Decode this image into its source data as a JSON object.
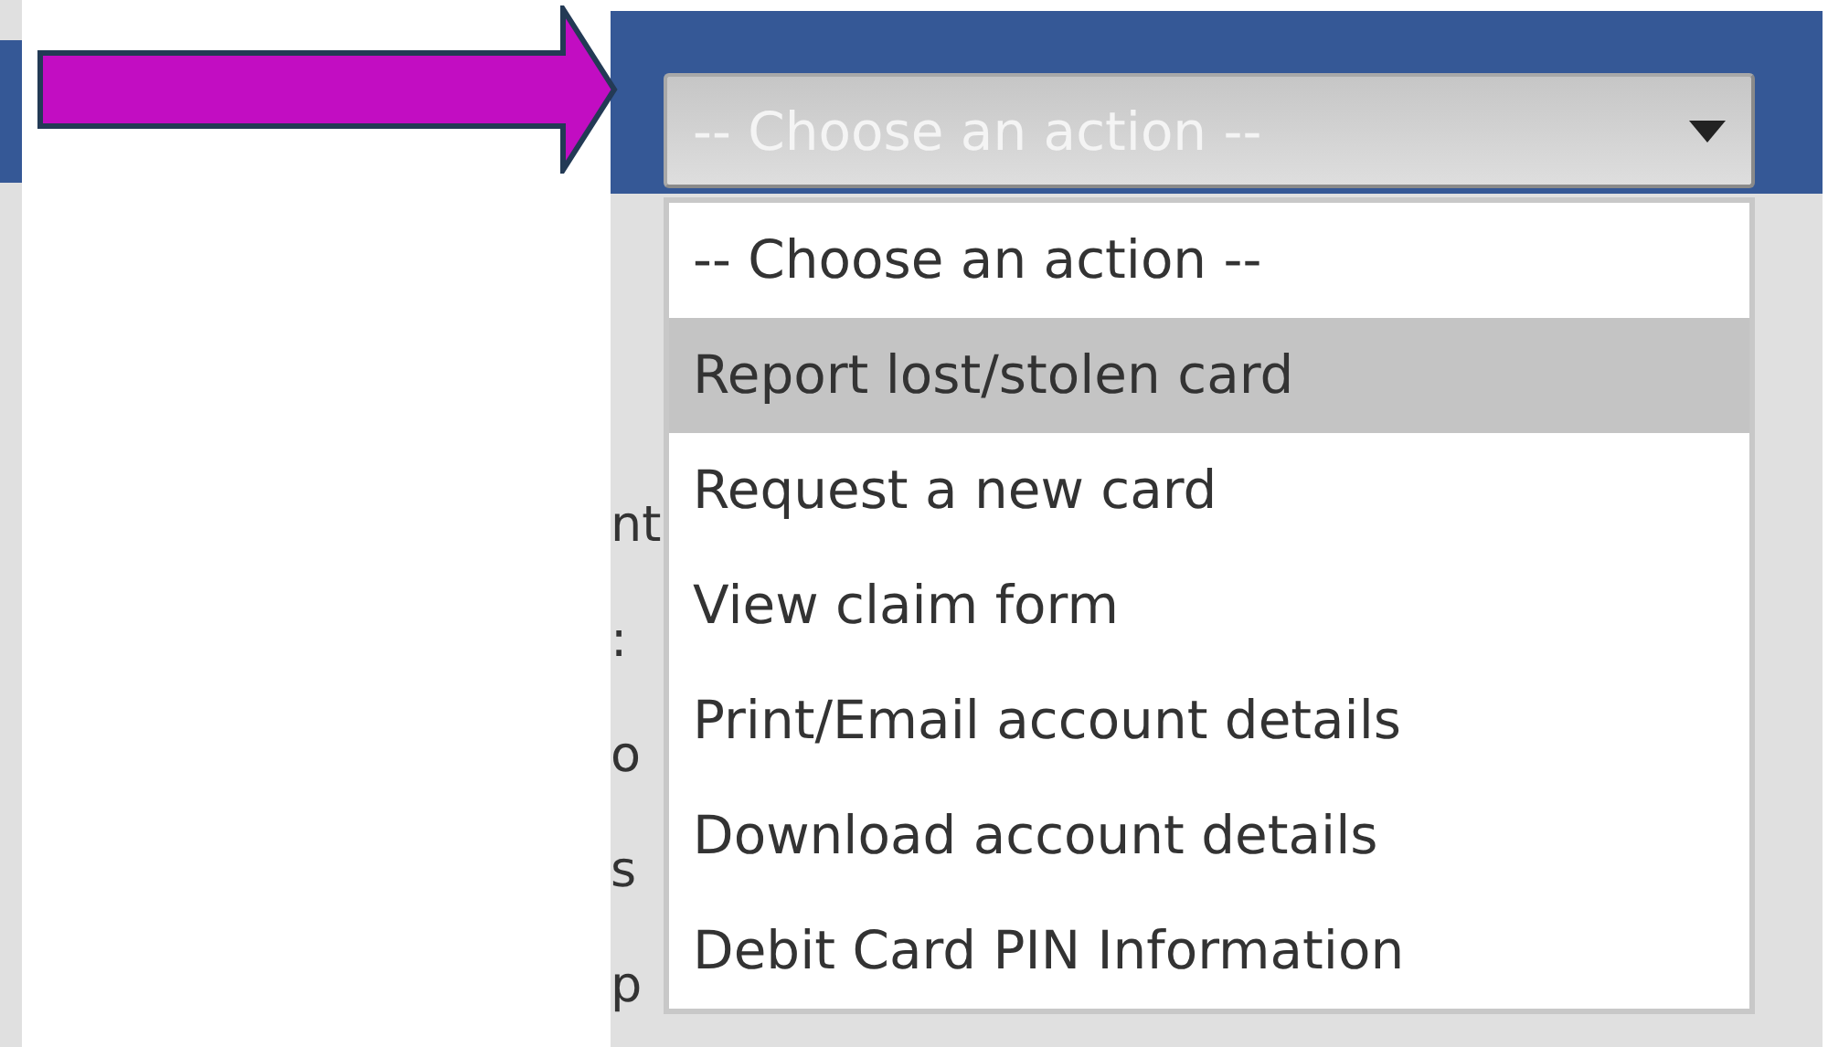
{
  "select": {
    "value": "-- Choose an action --",
    "expanded": true
  },
  "options": [
    {
      "label": "-- Choose an action --",
      "selected": false
    },
    {
      "label": "Report lost/stolen card",
      "selected": true
    },
    {
      "label": "Request a new card",
      "selected": false
    },
    {
      "label": "View claim form",
      "selected": false
    },
    {
      "label": "Print/Email account details",
      "selected": false
    },
    {
      "label": "Download account details",
      "selected": false
    },
    {
      "label": "Debit Card PIN Information",
      "selected": false
    }
  ],
  "obscured_text": [
    "nt",
    ":",
    "o",
    "s",
    "p"
  ]
}
